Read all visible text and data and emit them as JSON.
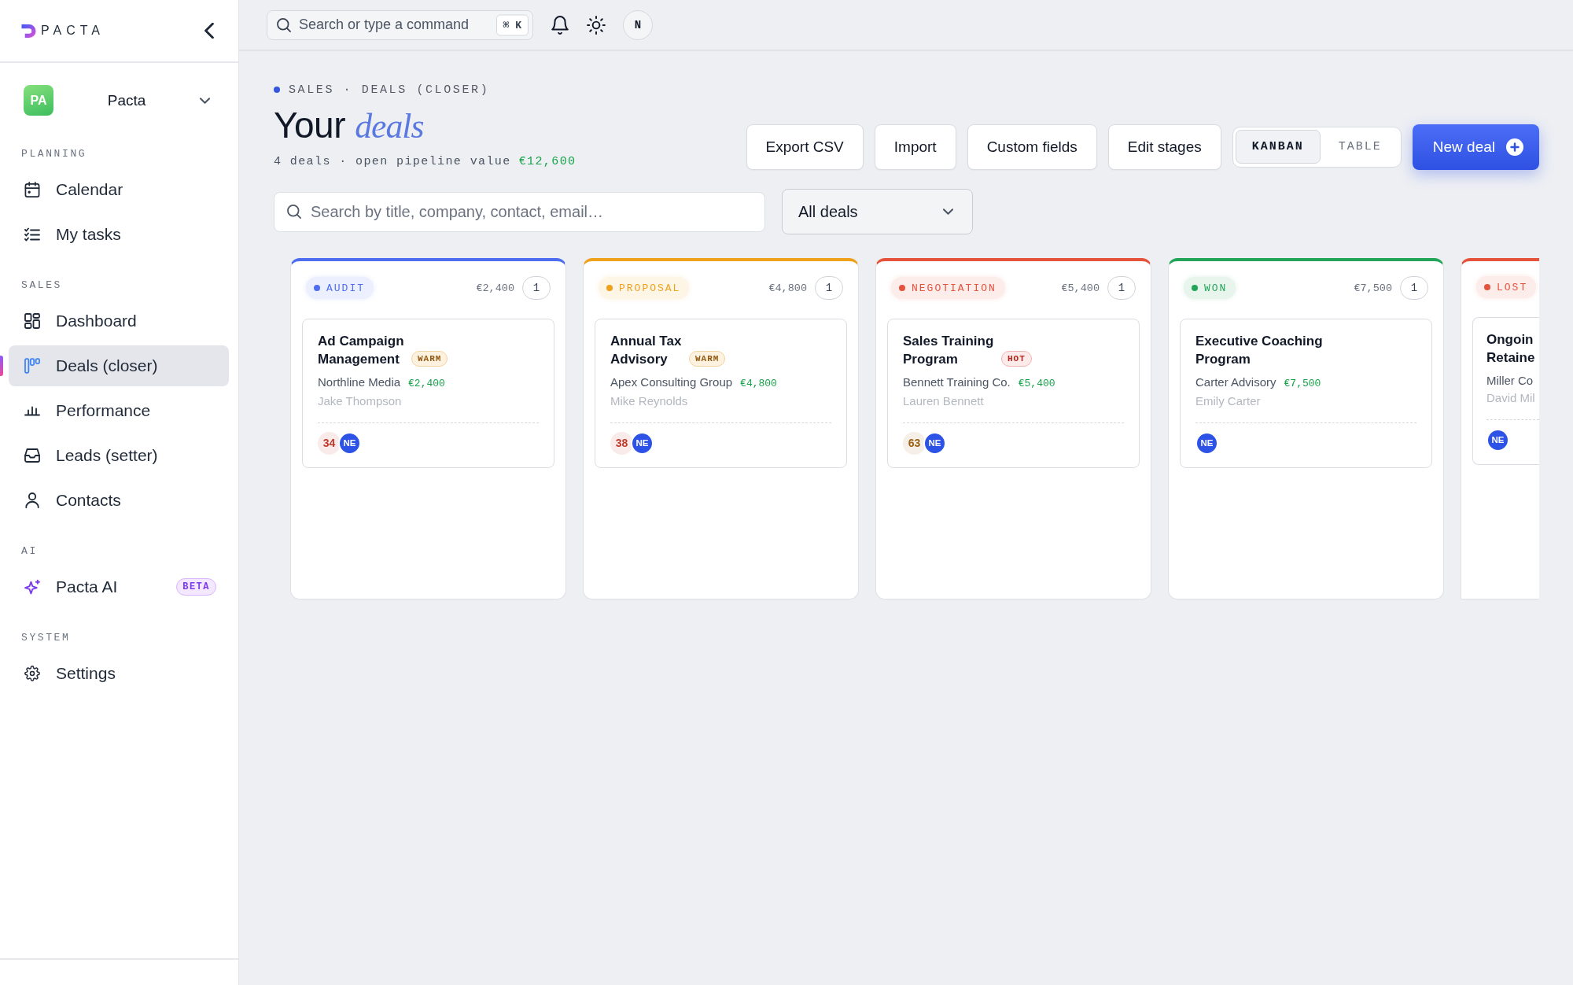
{
  "sidebar": {
    "logo": "PACTA",
    "workspace": {
      "initials": "PA",
      "name": "Pacta"
    },
    "sections": [
      {
        "label": "PLANNING",
        "items": [
          {
            "label": "Calendar",
            "selected": false
          },
          {
            "label": "My tasks",
            "selected": false
          }
        ]
      },
      {
        "label": "SALES",
        "items": [
          {
            "label": "Dashboard",
            "selected": false
          },
          {
            "label": "Deals (closer)",
            "selected": true
          },
          {
            "label": "Performance",
            "selected": false
          },
          {
            "label": "Leads (setter)",
            "selected": false
          },
          {
            "label": "Contacts",
            "selected": false
          }
        ]
      },
      {
        "label": "AI",
        "items": [
          {
            "label": "Pacta AI",
            "selected": false,
            "badge": "BETA"
          }
        ]
      },
      {
        "label": "SYSTEM",
        "items": [
          {
            "label": "Settings",
            "selected": false
          }
        ]
      }
    ]
  },
  "topbar": {
    "search": {
      "placeholder": "Search or type a command",
      "shortcut": "⌘ K"
    },
    "user_initial": "N"
  },
  "header": {
    "breadcrumb": "SALES · DEALS (CLOSER)",
    "title": "Your *deals*",
    "summary": "4 deals · open pipeline value",
    "pipeline_value": "€12,600",
    "actions": [
      "Export CSV",
      "Import",
      "Custom fields",
      "Edit stages"
    ],
    "view_tabs": [
      {
        "label": "KANBAN",
        "selected": true
      },
      {
        "label": "TABLE",
        "selected": false
      }
    ],
    "primary_action": "New deal"
  },
  "filters": {
    "search": {
      "placeholder": "Search by title, company, contact, email…"
    },
    "dropdown": {
      "value": "All deals"
    }
  },
  "board": {
    "columns": [
      {
        "stage": "AUDIT",
        "color": "#4f6df0",
        "total": "€2,400",
        "count": "1",
        "deals": [
          {
            "title": "Ad Campaign Management",
            "tag": {
              "text": "WARM",
              "kind": "warm"
            },
            "company": "Northline Media",
            "amount": "€2,400",
            "contact": "Jake Thompson",
            "score": {
              "text": "34",
              "color": "#c0392b"
            },
            "owner": "NE"
          }
        ]
      },
      {
        "stage": "PROPOSAL",
        "color": "#f0a11c",
        "total": "€4,800",
        "count": "1",
        "deals": [
          {
            "title": "Annual Tax Advisory",
            "tag": {
              "text": "WARM",
              "kind": "warm"
            },
            "company": "Apex Consulting Group",
            "amount": "€4,800",
            "contact": "Mike Reynolds",
            "score": {
              "text": "38",
              "color": "#c0392b"
            },
            "owner": "NE"
          }
        ]
      },
      {
        "stage": "NEGOTIATION",
        "color": "#e5533d",
        "total": "€5,400",
        "count": "1",
        "deals": [
          {
            "title": "Sales Training Program",
            "tag": {
              "text": "HOT",
              "kind": "hot"
            },
            "company": "Bennett Training Co.",
            "amount": "€5,400",
            "contact": "Lauren Bennett",
            "score": {
              "text": "63",
              "color": "#9a6212"
            },
            "owner": "NE"
          }
        ]
      },
      {
        "stage": "WON",
        "color": "#22a559",
        "total": "€7,500",
        "count": "1",
        "deals": [
          {
            "title": "Executive Coaching Program",
            "company": "Carter Advisory",
            "amount": "€7,500",
            "contact": "Emily Carter",
            "owner": "NE"
          }
        ]
      },
      {
        "stage": "LOST",
        "color": "#e5533d",
        "deals": [
          {
            "title": "Ongoin Retaine",
            "company": "Miller Co",
            "contact": "David Mil",
            "owner": "NE"
          }
        ]
      }
    ]
  }
}
